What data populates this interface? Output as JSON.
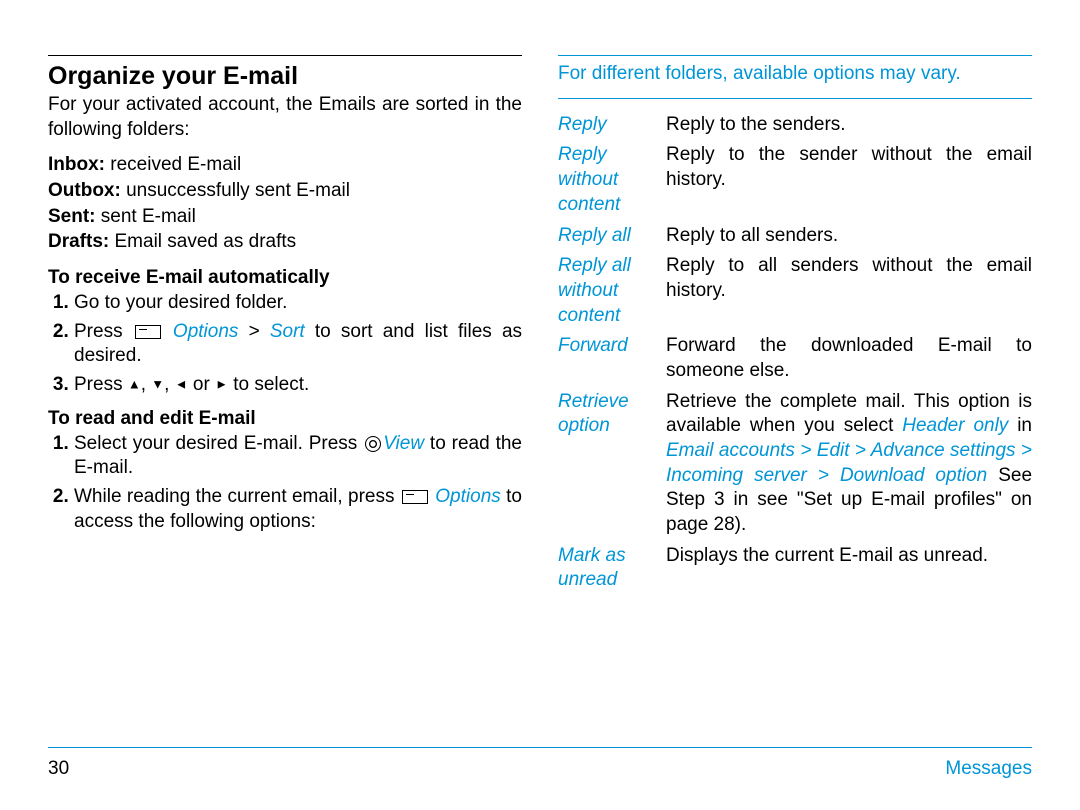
{
  "left": {
    "title": "Organize your E-mail",
    "intro": "For your activated account, the Emails are sorted in the following folders:",
    "folders": [
      {
        "name": "Inbox:",
        "desc": " received E-mail"
      },
      {
        "name": "Outbox:",
        "desc": " unsuccessfully sent E-mail"
      },
      {
        "name": "Sent:",
        "desc": " sent E-mail"
      },
      {
        "name": "Drafts:",
        "desc": " Email saved as drafts"
      }
    ],
    "sub1": "To receive E-mail automatically",
    "steps1": {
      "s1": "Go to your desired folder.",
      "s2a": "Press ",
      "s2b": " Options",
      "s2c": " > ",
      "s2d": "Sort",
      "s2e": " to sort and list files as desired.",
      "s3a": "Press ",
      "s3b": " to select."
    },
    "arrows": {
      "up": "▲",
      "down": "▼",
      "left": "◄",
      "right": "►",
      "comma": ", ",
      "or": " or "
    },
    "sub2": "To read and edit E-mail",
    "steps2": {
      "s1a": "Select your desired E-mail. Press ",
      "s1b": "View",
      "s1c": " to read the E-mail.",
      "s2a": "While reading the current email, press ",
      "s2b": " Options",
      "s2c": " to access the following options:"
    }
  },
  "right": {
    "note": "For different folders, available options may vary.",
    "rows": [
      {
        "label": "Reply",
        "desc": "Reply to the senders."
      },
      {
        "label": "Reply without content",
        "desc": "Reply to the sender without the email history."
      },
      {
        "label": "Reply all",
        "desc": "Reply to all senders."
      },
      {
        "label": "Reply all without content",
        "desc": "Reply to all senders without the email history."
      },
      {
        "label": "Forward",
        "desc": "Forward the downloaded E-mail to someone else."
      }
    ],
    "retrieve": {
      "label": "Retrieve option",
      "d1": "Retrieve the complete mail. This option is available when you select ",
      "d2": "Header only",
      "d3": " in ",
      "d4": "Email accounts",
      "d5": " > ",
      "d6": "Edit",
      "d7": " > ",
      "d8": "Advance settings",
      "d9": " > ",
      "d10": "Incoming server",
      "d11": " > ",
      "d12": "Download option",
      "d13": " See Step 3 in see \"Set up E-mail profiles\" on page 28)."
    },
    "mark": {
      "label": "Mark as unread",
      "desc": "Displays the current E-mail as unread."
    }
  },
  "footer": {
    "page": "30",
    "section": "Messages"
  }
}
